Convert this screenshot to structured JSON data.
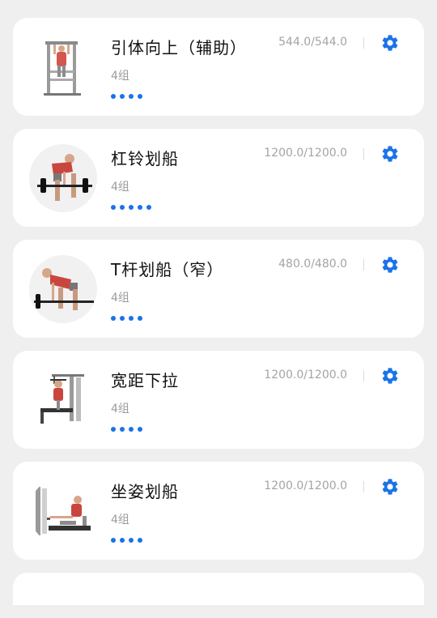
{
  "accent_color": "#1a73e8",
  "exercises": [
    {
      "title": "引体向上（辅助）",
      "sets": "4组",
      "weight": "544.0/544.0",
      "dot_count": 4,
      "image": "assisted-pullup-machine-illustration"
    },
    {
      "title": "杠铃划船",
      "sets": "4组",
      "weight": "1200.0/1200.0",
      "dot_count": 5,
      "image": "barbell-row-illustration"
    },
    {
      "title": "T杆划船（窄）",
      "sets": "4组",
      "weight": "480.0/480.0",
      "dot_count": 4,
      "image": "t-bar-row-illustration"
    },
    {
      "title": "宽距下拉",
      "sets": "4组",
      "weight": "1200.0/1200.0",
      "dot_count": 4,
      "image": "wide-grip-pulldown-illustration"
    },
    {
      "title": "坐姿划船",
      "sets": "4组",
      "weight": "1200.0/1200.0",
      "dot_count": 4,
      "image": "seated-cable-row-illustration"
    }
  ]
}
